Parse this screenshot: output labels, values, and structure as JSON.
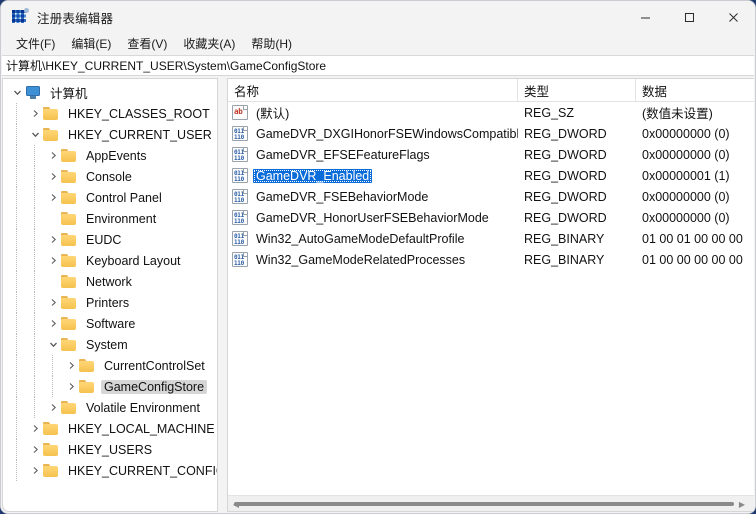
{
  "window": {
    "title": "注册表编辑器",
    "icon": "registry-icon",
    "controls": {
      "minimize": "minimize-icon",
      "maximize": "maximize-icon",
      "close": "close-icon"
    }
  },
  "menubar": {
    "items": [
      {
        "label": "文件(F)"
      },
      {
        "label": "编辑(E)"
      },
      {
        "label": "查看(V)"
      },
      {
        "label": "收藏夹(A)"
      },
      {
        "label": "帮助(H)"
      }
    ]
  },
  "address": {
    "path": "计算机\\HKEY_CURRENT_USER\\System\\GameConfigStore"
  },
  "tree": {
    "nodes": [
      {
        "label": "计算机",
        "depth": 0,
        "icon": "computer-icon",
        "state": "expanded",
        "selected": false
      },
      {
        "label": "HKEY_CLASSES_ROOT",
        "depth": 1,
        "icon": "folder-icon",
        "state": "collapsed",
        "selected": false
      },
      {
        "label": "HKEY_CURRENT_USER",
        "depth": 1,
        "icon": "folder-icon",
        "state": "expanded",
        "selected": false
      },
      {
        "label": "AppEvents",
        "depth": 2,
        "icon": "folder-icon",
        "state": "collapsed",
        "selected": false
      },
      {
        "label": "Console",
        "depth": 2,
        "icon": "folder-icon",
        "state": "collapsed",
        "selected": false
      },
      {
        "label": "Control Panel",
        "depth": 2,
        "icon": "folder-icon",
        "state": "collapsed",
        "selected": false
      },
      {
        "label": "Environment",
        "depth": 2,
        "icon": "folder-icon",
        "state": "leaf",
        "selected": false
      },
      {
        "label": "EUDC",
        "depth": 2,
        "icon": "folder-icon",
        "state": "collapsed",
        "selected": false
      },
      {
        "label": "Keyboard Layout",
        "depth": 2,
        "icon": "folder-icon",
        "state": "collapsed",
        "selected": false
      },
      {
        "label": "Network",
        "depth": 2,
        "icon": "folder-icon",
        "state": "leaf",
        "selected": false
      },
      {
        "label": "Printers",
        "depth": 2,
        "icon": "folder-icon",
        "state": "collapsed",
        "selected": false
      },
      {
        "label": "Software",
        "depth": 2,
        "icon": "folder-icon",
        "state": "collapsed",
        "selected": false
      },
      {
        "label": "System",
        "depth": 2,
        "icon": "folder-icon",
        "state": "expanded",
        "selected": false
      },
      {
        "label": "CurrentControlSet",
        "depth": 3,
        "icon": "folder-icon",
        "state": "collapsed",
        "selected": false
      },
      {
        "label": "GameConfigStore",
        "depth": 3,
        "icon": "folder-icon",
        "state": "collapsed",
        "selected": true
      },
      {
        "label": "Volatile Environment",
        "depth": 2,
        "icon": "folder-icon",
        "state": "collapsed",
        "selected": false
      },
      {
        "label": "HKEY_LOCAL_MACHINE",
        "depth": 1,
        "icon": "folder-icon",
        "state": "collapsed",
        "selected": false
      },
      {
        "label": "HKEY_USERS",
        "depth": 1,
        "icon": "folder-icon",
        "state": "collapsed",
        "selected": false
      },
      {
        "label": "HKEY_CURRENT_CONFIG",
        "depth": 1,
        "icon": "folder-icon",
        "state": "collapsed",
        "selected": false
      }
    ]
  },
  "list": {
    "columns": [
      {
        "label": "名称",
        "key": "name"
      },
      {
        "label": "类型",
        "key": "type"
      },
      {
        "label": "数据",
        "key": "data"
      }
    ],
    "rows": [
      {
        "name": "(默认)",
        "type": "REG_SZ",
        "data": "(数值未设置)",
        "icon": "string-value-icon",
        "selected": false
      },
      {
        "name": "GameDVR_DXGIHonorFSEWindowsCompatible",
        "type": "REG_DWORD",
        "data": "0x00000000 (0)",
        "icon": "binary-value-icon",
        "selected": false
      },
      {
        "name": "GameDVR_EFSEFeatureFlags",
        "type": "REG_DWORD",
        "data": "0x00000000 (0)",
        "icon": "binary-value-icon",
        "selected": false
      },
      {
        "name": "GameDVR_Enabled",
        "type": "REG_DWORD",
        "data": "0x00000001 (1)",
        "icon": "binary-value-icon",
        "selected": true
      },
      {
        "name": "GameDVR_FSEBehaviorMode",
        "type": "REG_DWORD",
        "data": "0x00000000 (0)",
        "icon": "binary-value-icon",
        "selected": false
      },
      {
        "name": "GameDVR_HonorUserFSEBehaviorMode",
        "type": "REG_DWORD",
        "data": "0x00000000 (0)",
        "icon": "binary-value-icon",
        "selected": false
      },
      {
        "name": "Win32_AutoGameModeDefaultProfile",
        "type": "REG_BINARY",
        "data": "01 00 01 00 00 00",
        "icon": "binary-value-icon",
        "selected": false
      },
      {
        "name": "Win32_GameModeRelatedProcesses",
        "type": "REG_BINARY",
        "data": "01 00 00 00 00 00",
        "icon": "binary-value-icon",
        "selected": false
      }
    ]
  },
  "colors": {
    "selection_blue": "#0a6cd8",
    "tree_selection_gray": "#d6d6d6",
    "folder_yellow": "#f5c24e",
    "window_bg": "#f3f3f3",
    "accent_icon_blue": "#2d6fbe"
  }
}
